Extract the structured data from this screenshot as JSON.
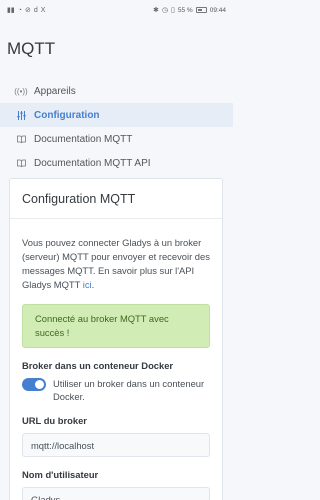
{
  "status_bar": {
    "left_icons": [
      "network-bars-icon",
      "wifi-icon",
      "d-icon",
      "x-icon"
    ],
    "battery": "55 %",
    "time": "09:44"
  },
  "app_title": "MQTT",
  "nav": [
    {
      "label": "Appareils",
      "icon": "broadcast-icon"
    },
    {
      "label": "Configuration",
      "icon": "sliders-icon",
      "active": true
    },
    {
      "label": "Documentation MQTT",
      "icon": "book-icon"
    },
    {
      "label": "Documentation MQTT API",
      "icon": "book-icon"
    }
  ],
  "card": {
    "title": "Configuration MQTT",
    "intro_text": "Vous pouvez connecter Gladys à un broker (serveur) MQTT pour envoyer et recevoir des messages MQTT. En savoir plus sur l'API Gladys MQTT ",
    "intro_link": "ici",
    "intro_end": ".",
    "alert": "Connecté au broker MQTT avec succès !",
    "docker_label": "Broker dans un conteneur Docker",
    "docker_toggle_text": "Utiliser un broker dans un conteneur Docker.",
    "docker_toggle_on": true,
    "url_label": "URL du broker",
    "url_value": "mqtt://localhost",
    "user_label": "Nom d'utilisateur",
    "user_value": "Gladys"
  },
  "colors": {
    "accent": "#467fcf",
    "success_bg": "#d2ecb6",
    "success_text": "#3c6a1b"
  }
}
